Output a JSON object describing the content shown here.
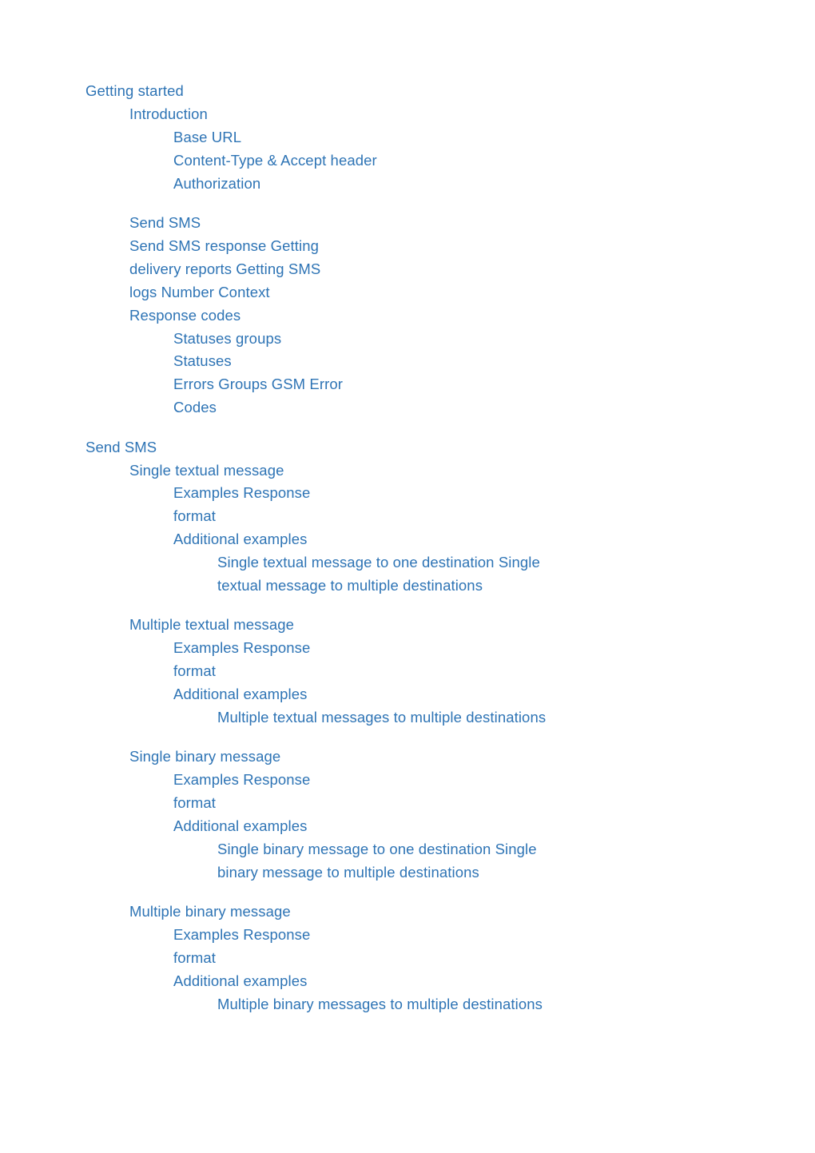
{
  "document": {
    "type": "table-of-contents",
    "link_color": "#2e74b5",
    "entries": [
      {
        "text": "Getting started",
        "level": 0
      },
      {
        "text": "Introduction",
        "level": 1
      },
      {
        "text": "Base URL",
        "level": 2
      },
      {
        "text": "Content-Type & Accept header",
        "level": 2
      },
      {
        "text": "Authorization",
        "level": 2,
        "gap_after": true
      },
      {
        "text": "Send SMS",
        "level": 1
      },
      {
        "text": "Send SMS response Getting",
        "level": 1
      },
      {
        "text": "delivery reports Getting SMS",
        "level": 1
      },
      {
        "text": "logs Number Context",
        "level": 1
      },
      {
        "text": "Response codes",
        "level": 1
      },
      {
        "text": "Statuses groups",
        "level": 2
      },
      {
        "text": "Statuses",
        "level": 2
      },
      {
        "text": "Errors Groups GSM Error",
        "level": 2
      },
      {
        "text": "Codes",
        "level": 2,
        "gap_after": true
      },
      {
        "text": "Send SMS",
        "level": 0
      },
      {
        "text": "Single textual message",
        "level": 1
      },
      {
        "text": "Examples Response",
        "level": 2
      },
      {
        "text": "format",
        "level": 2
      },
      {
        "text": "Additional examples",
        "level": 2
      },
      {
        "text": "Single textual message to one destination Single",
        "level": 3
      },
      {
        "text": "textual message to multiple destinations",
        "level": 3,
        "gap_after": true
      },
      {
        "text": "Multiple textual message",
        "level": 1
      },
      {
        "text": "Examples Response",
        "level": 2
      },
      {
        "text": "format",
        "level": 2
      },
      {
        "text": "Additional examples",
        "level": 2
      },
      {
        "text": "Multiple textual messages to multiple destinations",
        "level": 3,
        "gap_after": true
      },
      {
        "text": "Single binary message",
        "level": 1
      },
      {
        "text": "Examples Response",
        "level": 2
      },
      {
        "text": "format",
        "level": 2
      },
      {
        "text": "Additional examples",
        "level": 2
      },
      {
        "text": "Single binary message to one destination Single",
        "level": 3
      },
      {
        "text": "binary message to multiple destinations",
        "level": 3,
        "gap_after": true
      },
      {
        "text": "Multiple binary message",
        "level": 1
      },
      {
        "text": "Examples Response",
        "level": 2
      },
      {
        "text": "format",
        "level": 2
      },
      {
        "text": "Additional examples",
        "level": 2
      },
      {
        "text": "Multiple binary messages to multiple destinations",
        "level": 3
      }
    ]
  }
}
